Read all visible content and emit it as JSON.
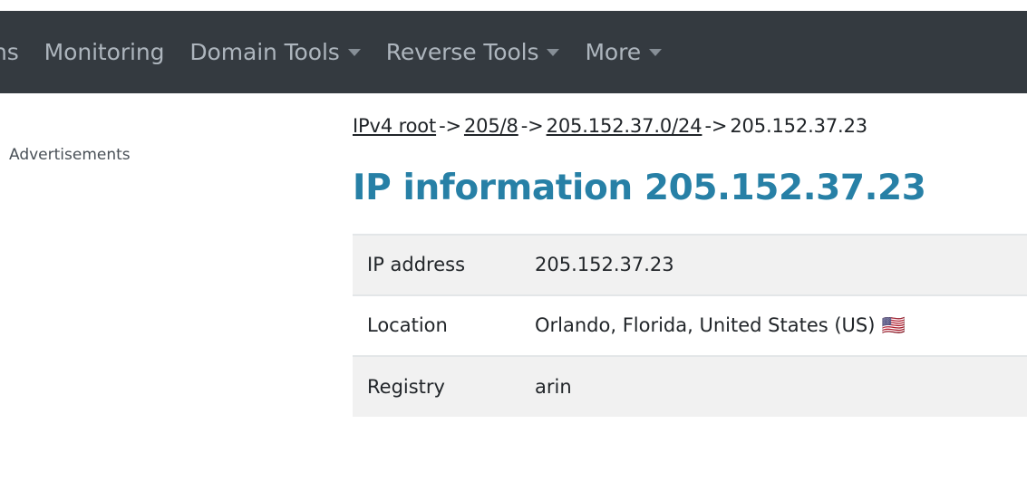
{
  "navbar": {
    "background": "#343a40",
    "text_color": "#adb5bd",
    "items": [
      {
        "label": "ns",
        "has_caret": false,
        "truncated": true
      },
      {
        "label": "Monitoring",
        "has_caret": false
      },
      {
        "label": "Domain Tools",
        "has_caret": true
      },
      {
        "label": "Reverse Tools",
        "has_caret": true
      },
      {
        "label": "More",
        "has_caret": true
      }
    ]
  },
  "sidebar": {
    "ads_label": "Advertisements"
  },
  "breadcrumb": {
    "items": [
      {
        "label": "IPv4 root",
        "link": true
      },
      {
        "label": "205/8",
        "link": true
      },
      {
        "label": "205.152.37.0/24",
        "link": true
      },
      {
        "label": "205.152.37.23",
        "link": false
      }
    ],
    "separator": "->"
  },
  "main": {
    "title": "IP information 205.152.37.23",
    "title_color": "#2780a6",
    "table": {
      "rows": [
        {
          "label": "IP address",
          "value": "205.152.37.23",
          "flag": ""
        },
        {
          "label": "Location",
          "value": "Orlando, Florida, United States (US)",
          "flag": "🇺🇸"
        },
        {
          "label": "Registry",
          "value": "arin",
          "flag": ""
        }
      ],
      "stripe_color": "#f1f1f1",
      "border_color": "#e3e6e8"
    }
  }
}
